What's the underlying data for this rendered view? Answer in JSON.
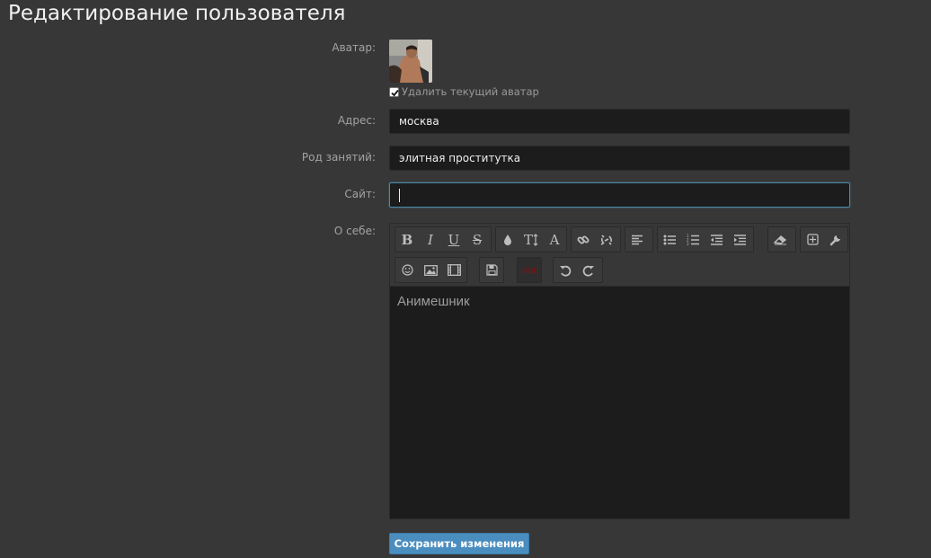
{
  "page": {
    "title": "Редактирование пользователя"
  },
  "form": {
    "avatar_label": "Аватар:",
    "delete_avatar_label": "Удалить текущий аватар",
    "delete_avatar_checked": true,
    "address_label": "Адрес:",
    "address_value": "москва",
    "occupation_label": "Род занятий:",
    "occupation_value": "элитная проститутка",
    "site_label": "Сайт:",
    "site_value": "",
    "about_label": "О себе:",
    "about_value": "Анимешник",
    "save_label": "Сохранить изменения"
  },
  "toolbar": {
    "bold": "B",
    "italic": "I",
    "underline": "U",
    "strike": "S",
    "font_size": "T",
    "font": "A",
    "hide": "HIDE"
  },
  "colors": {
    "background": "#373737",
    "input_bg": "#1c1c1c",
    "focus_border": "#4a89a8",
    "button_bg": "#4a8dbf"
  }
}
